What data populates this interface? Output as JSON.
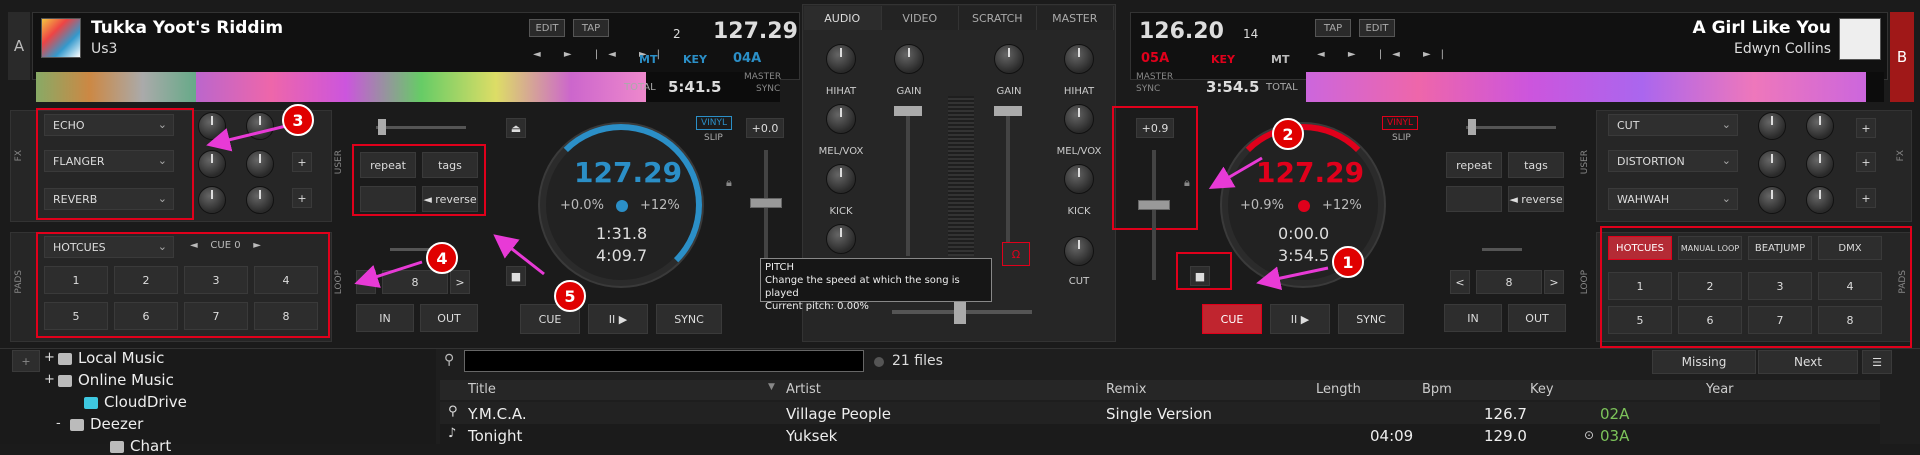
{
  "deck_a": {
    "letter": "A",
    "title": "Tukka Yoot's Riddim",
    "artist": "Us3",
    "edit": "EDIT",
    "tap": "TAP",
    "bpm": "127.29",
    "deck_num": "2",
    "mt": "MT",
    "key_label": "KEY",
    "key": "04A",
    "total_label": "TOTAL",
    "total": "5:41.5",
    "master": "MASTER",
    "sync_label": "SYNC",
    "fx": [
      "ECHO",
      "FLANGER",
      "REVERB"
    ],
    "fx_side": "FX",
    "user_side": "USER",
    "repeat": "repeat",
    "tags": "tags",
    "reverse": "◄ reverse",
    "pads_side": "PADS",
    "loop_side": "LOOP",
    "pads_mode": "HOTCUES",
    "cue_label": "CUE 0",
    "pads": [
      "1",
      "2",
      "3",
      "4",
      "5",
      "6",
      "7",
      "8"
    ],
    "loop_size": "8",
    "in": "IN",
    "out": "OUT",
    "vinyl": "VINYL",
    "slip": "SLIP",
    "pitch_value": "+0.0",
    "jog_bpm": "127.29",
    "pitch_pct": "+0.0%",
    "pitch_range": "+12%",
    "elapsed": "1:31.8",
    "remaining": "4:09.7",
    "cue": "CUE",
    "play": "II ▶",
    "sync": "SYNC"
  },
  "deck_b": {
    "letter": "B",
    "title": "A Girl Like You",
    "artist": "Edwyn Collins",
    "edit": "EDIT",
    "tap": "TAP",
    "bpm": "126.20",
    "deck_num": "14",
    "mt": "MT",
    "key_label": "KEY",
    "key": "05A",
    "total_label": "TOTAL",
    "total": "3:54.5",
    "master": "MASTER",
    "sync_label": "SYNC",
    "fx": [
      "CUT",
      "DISTORTION",
      "WAHWAH"
    ],
    "fx_side": "FX",
    "user_side": "USER",
    "repeat": "repeat",
    "tags": "tags",
    "reverse": "◄ reverse",
    "pads_side": "PADS",
    "loop_side": "LOOP",
    "pad_modes": [
      "HOTCUES",
      "MANUAL LOOP",
      "BEATJUMP",
      "DMX"
    ],
    "pads": [
      "1",
      "2",
      "3",
      "4",
      "5",
      "6",
      "7",
      "8"
    ],
    "loop_size": "8",
    "in": "IN",
    "out": "OUT",
    "vinyl": "VINYL",
    "slip": "SLIP",
    "pitch_value": "+0.9",
    "jog_bpm": "127.29",
    "pitch_pct": "+0.9%",
    "pitch_range": "+12%",
    "elapsed": "0:00.0",
    "remaining": "3:54.5",
    "cue": "CUE",
    "play": "II ▶",
    "sync": "SYNC"
  },
  "mixer": {
    "tabs": [
      "AUDIO",
      "VIDEO",
      "SCRATCH",
      "MASTER"
    ],
    "gain": "GAIN",
    "hihat": "HIHAT",
    "melvox": "MEL/VOX",
    "kick": "KICK",
    "cut": "CUT"
  },
  "tooltip": {
    "title": "PITCH",
    "line1": "Change the speed at which the song is played",
    "line2": "Current pitch: 0.00%"
  },
  "callouts": [
    "1",
    "2",
    "3",
    "4",
    "5"
  ],
  "browser": {
    "tree": [
      {
        "label": "Local Music",
        "prefix": "+"
      },
      {
        "label": "Online Music",
        "prefix": "+"
      },
      {
        "label": "CloudDrive",
        "prefix": ""
      },
      {
        "label": "Deezer",
        "prefix": "-"
      },
      {
        "label": "Chart",
        "prefix": ""
      }
    ],
    "file_count": "21 files",
    "missing": "Missing",
    "next": "Next",
    "columns": [
      "Title",
      "Artist",
      "Remix",
      "Length",
      "Bpm",
      "Key",
      "Year"
    ],
    "rows": [
      {
        "title": "Y.M.C.A.",
        "artist": "Village People",
        "remix": "Single Version",
        "length": "",
        "bpm": "126.7",
        "key": "02A"
      },
      {
        "title": "Tonight",
        "artist": "Yuksek",
        "remix": "",
        "length": "04:09",
        "bpm": "129.0",
        "key": "03A"
      }
    ]
  },
  "colors": {
    "accent_blue": "#2b8fc7",
    "accent_red": "#e0001b",
    "key_green": "#7cc35a"
  }
}
